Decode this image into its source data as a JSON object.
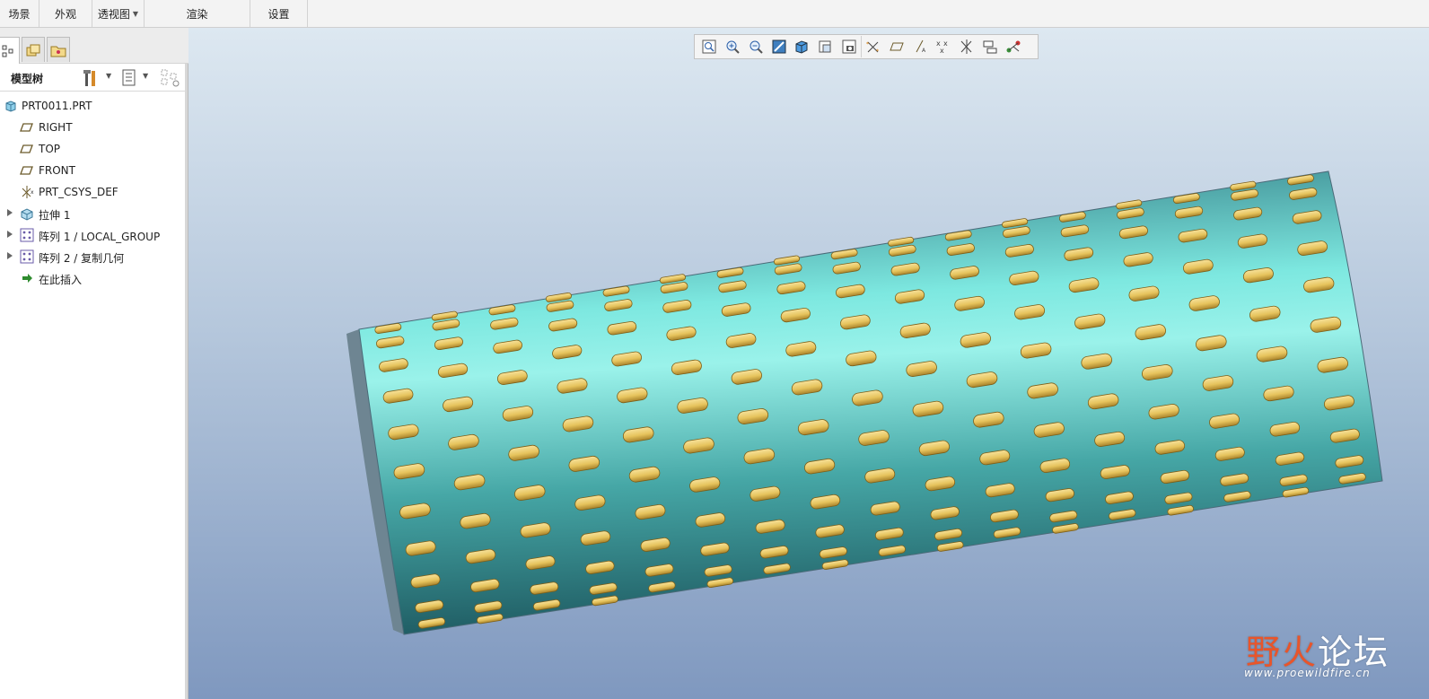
{
  "ribbon": {
    "groups": [
      "场景",
      "外观",
      "透视图",
      "渲染",
      "设置"
    ]
  },
  "left_panel": {
    "title": "模型树",
    "tabs": [
      "model-tree",
      "layers",
      "folder-browser"
    ],
    "tree": [
      {
        "label": "PRT0011.PRT",
        "icon": "part-icon",
        "expandable": false
      },
      {
        "label": "RIGHT",
        "icon": "datum-plane-icon",
        "expandable": false
      },
      {
        "label": "TOP",
        "icon": "datum-plane-icon",
        "expandable": false
      },
      {
        "label": "FRONT",
        "icon": "datum-plane-icon",
        "expandable": false
      },
      {
        "label": "PRT_CSYS_DEF",
        "icon": "csys-icon",
        "expandable": false
      },
      {
        "label": "拉伸 1",
        "icon": "extrude-icon",
        "expandable": true
      },
      {
        "label": "阵列 1 / LOCAL_GROUP",
        "icon": "pattern-icon",
        "expandable": true
      },
      {
        "label": "阵列 2 / 复制几何",
        "icon": "pattern-icon",
        "expandable": true
      },
      {
        "label": "在此插入",
        "icon": "insert-here-icon",
        "expandable": false
      }
    ]
  },
  "viewport": {
    "toolbar_icons": [
      "refit-icon",
      "zoom-in-icon",
      "zoom-out-icon",
      "repaint-icon",
      "display-style-icon",
      "saved-orientations-icon",
      "view-manager-icon",
      "datum-display-icon",
      "plane-display-icon",
      "axis-display-icon",
      "point-display-icon",
      "csys-display-icon",
      "annotation-display-icon",
      "spin-center-icon"
    ],
    "watermark": {
      "title_a": "野",
      "title_b": "火",
      "title_c": "论坛",
      "url": "www.proewildfire.cn"
    }
  },
  "colors": {
    "cylinder_light": "#7de8e0",
    "cylinder_dark": "#256a6e",
    "bump_gold": "#e6c35c",
    "accent": "#e8552b"
  }
}
